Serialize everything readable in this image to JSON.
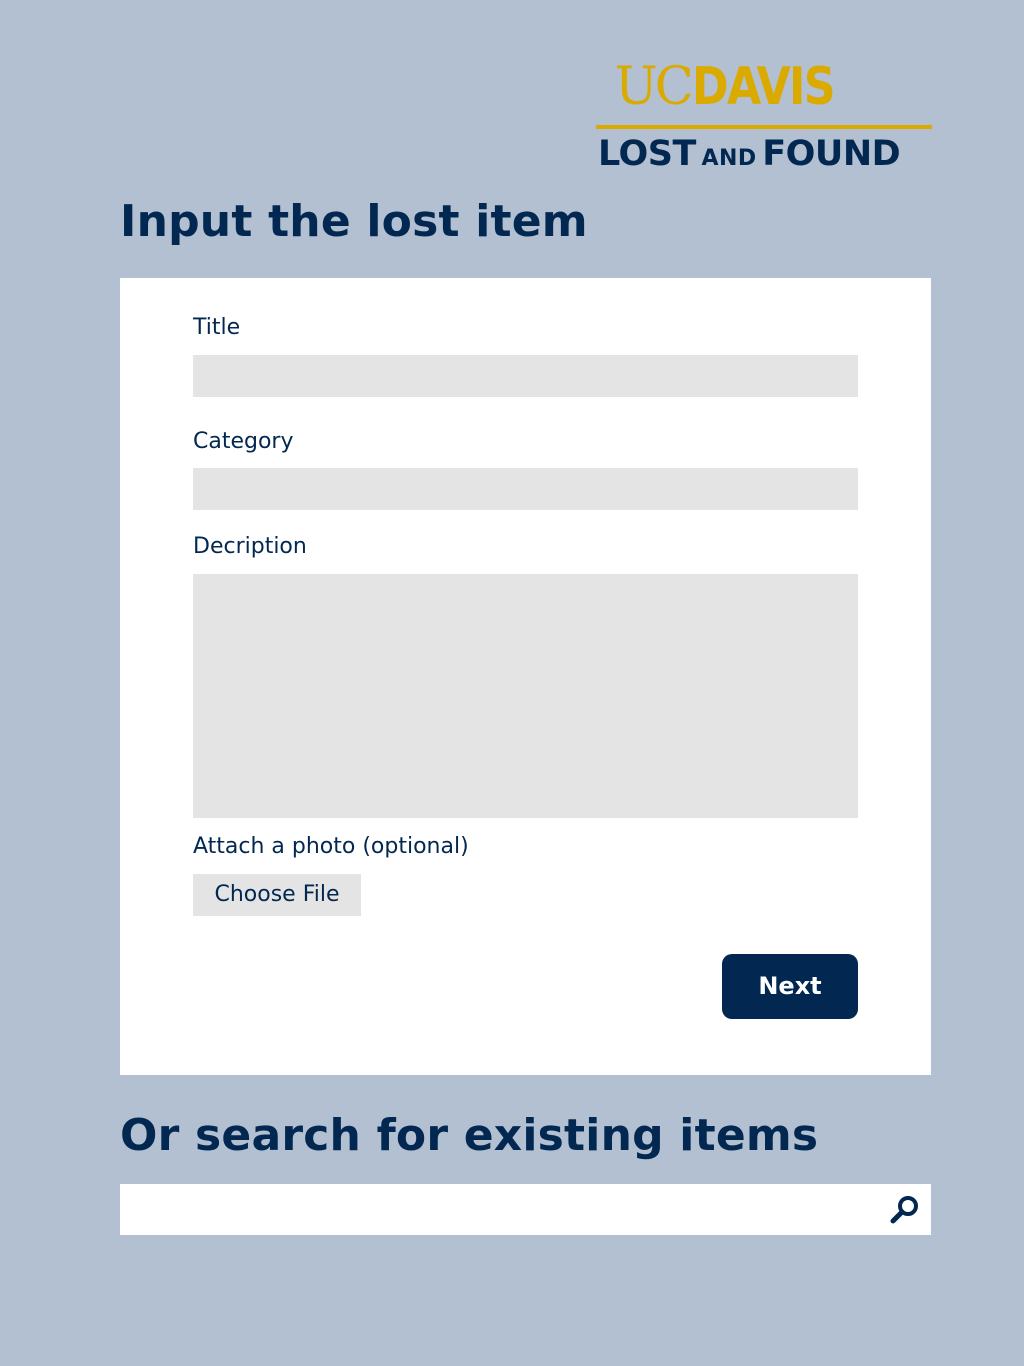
{
  "logo": {
    "uc": "UC",
    "davis": "DAVIS",
    "lost": "LOST",
    "and": "AND",
    "found": "FOUND"
  },
  "form": {
    "heading": "Input the lost item",
    "title_label": "Title",
    "title_value": "",
    "category_label": "Category",
    "category_value": "",
    "description_label": "Decription",
    "description_value": "",
    "photo_label": "Attach a photo (optional)",
    "file_button": "Choose File",
    "next_button": "Next"
  },
  "search": {
    "heading": "Or search for existing items",
    "value": "",
    "icon": "search-icon"
  },
  "colors": {
    "background": "#b2c0d2",
    "navy": "#022851",
    "gold": "#daaa00",
    "field": "#e4e4e4",
    "card": "#ffffff"
  }
}
